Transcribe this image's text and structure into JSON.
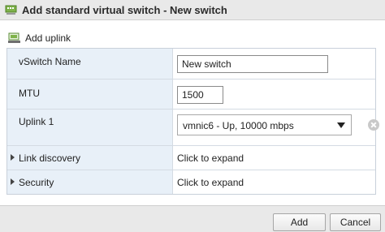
{
  "window": {
    "title": "Add standard virtual switch - New switch"
  },
  "toolbar": {
    "add_uplink_label": "Add uplink"
  },
  "form": {
    "vswitch_name": {
      "label": "vSwitch Name",
      "value": "New switch"
    },
    "mtu": {
      "label": "MTU",
      "value": "1500"
    },
    "uplink1": {
      "label": "Uplink 1",
      "selected": "vmnic6 - Up, 10000 mbps"
    },
    "link_discovery": {
      "label": "Link discovery",
      "action": "Click to expand"
    },
    "security": {
      "label": "Security",
      "action": "Click to expand"
    }
  },
  "footer": {
    "add_label": "Add",
    "cancel_label": "Cancel"
  },
  "icons": {
    "title_icon": "virtual-switch-icon",
    "add_uplink_icon": "network-adapter-icon",
    "remove_uplink_icon": "remove-icon",
    "dropdown_icon": "chevron-down-icon",
    "expand_icon": "caret-right-icon"
  }
}
